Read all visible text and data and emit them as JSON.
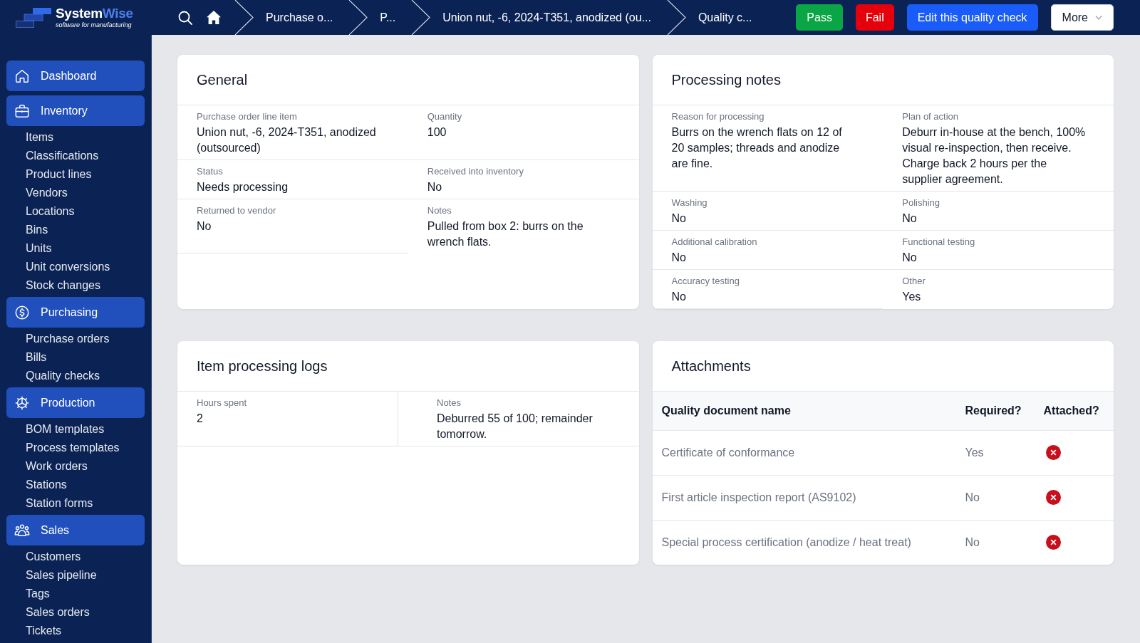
{
  "top_bar": {
    "logo": {
      "name_lead": "System",
      "name_accent": "Wise",
      "tagline": "software for manufacturing"
    },
    "breadcrumbs": [
      "Purchase o...",
      "P...",
      "Union nut, -6, 2024-T351, anodized (ou...",
      "Quality c..."
    ],
    "actions": [
      {
        "label": "Pass",
        "kind": "success"
      },
      {
        "label": "Fail",
        "kind": "danger"
      },
      {
        "label": "Edit this quality check",
        "kind": "primary"
      },
      {
        "label": "More",
        "kind": "menu"
      }
    ]
  },
  "sidebar": {
    "sections": [
      {
        "label": "Dashboard"
      },
      {
        "label": "Inventory",
        "items": [
          "Items",
          "Classifications",
          "Product lines",
          "Vendors",
          "Locations",
          "Bins",
          "Units",
          "Unit conversions",
          "Stock changes"
        ]
      },
      {
        "label": "Purchasing",
        "items": [
          "Purchase orders",
          "Bills",
          "Quality checks"
        ]
      },
      {
        "label": "Production",
        "items": [
          "BOM templates",
          "Process templates",
          "Work orders",
          "Stations",
          "Station forms"
        ]
      },
      {
        "label": "Sales",
        "items": [
          "Customers",
          "Sales pipeline",
          "Tags",
          "Sales orders",
          "Tickets"
        ]
      }
    ]
  },
  "general": {
    "title": "General",
    "fields": [
      {
        "label": "Purchase order line item",
        "value": "Union nut, -6, 2024-T351, anodized (outsourced)"
      },
      {
        "label": "Quantity",
        "value": "100"
      },
      {
        "label": "Status",
        "value": "Needs processing"
      },
      {
        "label": "Received into inventory",
        "value": "No"
      },
      {
        "label": "Returned to vendor",
        "value": "No"
      },
      {
        "label": "Notes",
        "value": "Pulled from box 2: burrs on the wrench flats."
      }
    ]
  },
  "processing_notes": {
    "title": "Processing notes",
    "fields": [
      {
        "label": "Reason for processing",
        "value": "Burrs on the wrench flats on 12 of 20 samples; threads and anodize are fine."
      },
      {
        "label": "Plan of action",
        "value": "Deburr in-house at the bench, 100% visual re-inspection, then receive. Charge back 2 hours per the supplier agreement."
      },
      {
        "label": "Washing",
        "value": "No"
      },
      {
        "label": "Polishing",
        "value": "No"
      },
      {
        "label": "Additional calibration",
        "value": "No"
      },
      {
        "label": "Functional testing",
        "value": "No"
      },
      {
        "label": "Accuracy testing",
        "value": "No"
      },
      {
        "label": "Other",
        "value": "Yes"
      }
    ]
  },
  "item_processing_logs": {
    "title": "Item processing logs",
    "fields": [
      {
        "label": "Hours spent",
        "value": "2"
      },
      {
        "label": "Notes",
        "value": "Deburred 55 of 100; remainder tomorrow."
      }
    ]
  },
  "attachments": {
    "title": "Attachments",
    "columns": [
      "Quality document name",
      "Required?",
      "Attached?"
    ],
    "rows": [
      {
        "name": "Certificate of conformance",
        "required": "Yes",
        "attached": false
      },
      {
        "name": "First article inspection report (AS9102)",
        "required": "No",
        "attached": false
      },
      {
        "name": "Special process certification (anodize / heat treat)",
        "required": "No",
        "attached": false
      }
    ]
  }
}
